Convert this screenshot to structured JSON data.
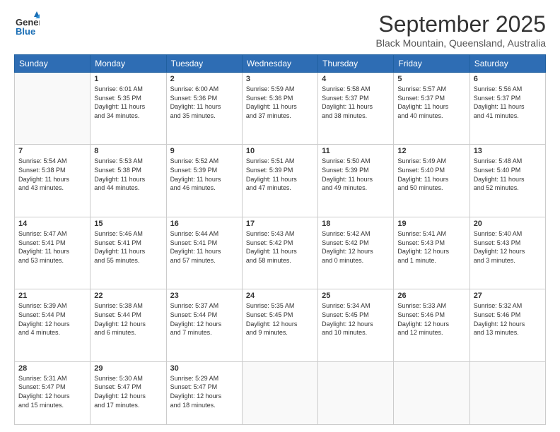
{
  "logo": {
    "general": "General",
    "blue": "Blue"
  },
  "title": "September 2025",
  "location": "Black Mountain, Queensland, Australia",
  "headers": [
    "Sunday",
    "Monday",
    "Tuesday",
    "Wednesday",
    "Thursday",
    "Friday",
    "Saturday"
  ],
  "weeks": [
    [
      {
        "day": "",
        "content": ""
      },
      {
        "day": "1",
        "content": "Sunrise: 6:01 AM\nSunset: 5:35 PM\nDaylight: 11 hours\nand 34 minutes."
      },
      {
        "day": "2",
        "content": "Sunrise: 6:00 AM\nSunset: 5:36 PM\nDaylight: 11 hours\nand 35 minutes."
      },
      {
        "day": "3",
        "content": "Sunrise: 5:59 AM\nSunset: 5:36 PM\nDaylight: 11 hours\nand 37 minutes."
      },
      {
        "day": "4",
        "content": "Sunrise: 5:58 AM\nSunset: 5:37 PM\nDaylight: 11 hours\nand 38 minutes."
      },
      {
        "day": "5",
        "content": "Sunrise: 5:57 AM\nSunset: 5:37 PM\nDaylight: 11 hours\nand 40 minutes."
      },
      {
        "day": "6",
        "content": "Sunrise: 5:56 AM\nSunset: 5:37 PM\nDaylight: 11 hours\nand 41 minutes."
      }
    ],
    [
      {
        "day": "7",
        "content": "Sunrise: 5:54 AM\nSunset: 5:38 PM\nDaylight: 11 hours\nand 43 minutes."
      },
      {
        "day": "8",
        "content": "Sunrise: 5:53 AM\nSunset: 5:38 PM\nDaylight: 11 hours\nand 44 minutes."
      },
      {
        "day": "9",
        "content": "Sunrise: 5:52 AM\nSunset: 5:39 PM\nDaylight: 11 hours\nand 46 minutes."
      },
      {
        "day": "10",
        "content": "Sunrise: 5:51 AM\nSunset: 5:39 PM\nDaylight: 11 hours\nand 47 minutes."
      },
      {
        "day": "11",
        "content": "Sunrise: 5:50 AM\nSunset: 5:39 PM\nDaylight: 11 hours\nand 49 minutes."
      },
      {
        "day": "12",
        "content": "Sunrise: 5:49 AM\nSunset: 5:40 PM\nDaylight: 11 hours\nand 50 minutes."
      },
      {
        "day": "13",
        "content": "Sunrise: 5:48 AM\nSunset: 5:40 PM\nDaylight: 11 hours\nand 52 minutes."
      }
    ],
    [
      {
        "day": "14",
        "content": "Sunrise: 5:47 AM\nSunset: 5:41 PM\nDaylight: 11 hours\nand 53 minutes."
      },
      {
        "day": "15",
        "content": "Sunrise: 5:46 AM\nSunset: 5:41 PM\nDaylight: 11 hours\nand 55 minutes."
      },
      {
        "day": "16",
        "content": "Sunrise: 5:44 AM\nSunset: 5:41 PM\nDaylight: 11 hours\nand 57 minutes."
      },
      {
        "day": "17",
        "content": "Sunrise: 5:43 AM\nSunset: 5:42 PM\nDaylight: 11 hours\nand 58 minutes."
      },
      {
        "day": "18",
        "content": "Sunrise: 5:42 AM\nSunset: 5:42 PM\nDaylight: 12 hours\nand 0 minutes."
      },
      {
        "day": "19",
        "content": "Sunrise: 5:41 AM\nSunset: 5:43 PM\nDaylight: 12 hours\nand 1 minute."
      },
      {
        "day": "20",
        "content": "Sunrise: 5:40 AM\nSunset: 5:43 PM\nDaylight: 12 hours\nand 3 minutes."
      }
    ],
    [
      {
        "day": "21",
        "content": "Sunrise: 5:39 AM\nSunset: 5:44 PM\nDaylight: 12 hours\nand 4 minutes."
      },
      {
        "day": "22",
        "content": "Sunrise: 5:38 AM\nSunset: 5:44 PM\nDaylight: 12 hours\nand 6 minutes."
      },
      {
        "day": "23",
        "content": "Sunrise: 5:37 AM\nSunset: 5:44 PM\nDaylight: 12 hours\nand 7 minutes."
      },
      {
        "day": "24",
        "content": "Sunrise: 5:35 AM\nSunset: 5:45 PM\nDaylight: 12 hours\nand 9 minutes."
      },
      {
        "day": "25",
        "content": "Sunrise: 5:34 AM\nSunset: 5:45 PM\nDaylight: 12 hours\nand 10 minutes."
      },
      {
        "day": "26",
        "content": "Sunrise: 5:33 AM\nSunset: 5:46 PM\nDaylight: 12 hours\nand 12 minutes."
      },
      {
        "day": "27",
        "content": "Sunrise: 5:32 AM\nSunset: 5:46 PM\nDaylight: 12 hours\nand 13 minutes."
      }
    ],
    [
      {
        "day": "28",
        "content": "Sunrise: 5:31 AM\nSunset: 5:47 PM\nDaylight: 12 hours\nand 15 minutes."
      },
      {
        "day": "29",
        "content": "Sunrise: 5:30 AM\nSunset: 5:47 PM\nDaylight: 12 hours\nand 17 minutes."
      },
      {
        "day": "30",
        "content": "Sunrise: 5:29 AM\nSunset: 5:47 PM\nDaylight: 12 hours\nand 18 minutes."
      },
      {
        "day": "",
        "content": ""
      },
      {
        "day": "",
        "content": ""
      },
      {
        "day": "",
        "content": ""
      },
      {
        "day": "",
        "content": ""
      }
    ]
  ]
}
